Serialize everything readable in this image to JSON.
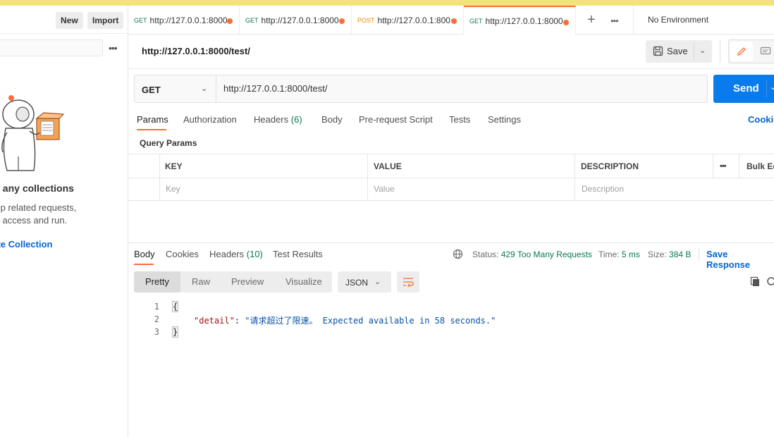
{
  "sidebar": {
    "new_label": "New",
    "import_label": "Import",
    "empty_title": "have any collections",
    "empty_desc_1": "you group related requests,",
    "empty_desc_2": "easier to access and run.",
    "create_link": "eate Collection"
  },
  "tabs": [
    {
      "method": "GET",
      "url": "http://127.0.0.1:8000"
    },
    {
      "method": "GET",
      "url": "http://127.0.0.1:8000"
    },
    {
      "method": "POST",
      "url": "http://127.0.0.1:800"
    },
    {
      "method": "GET",
      "url": "http://127.0.0.1:8000",
      "active": true
    }
  ],
  "environment": "No Environment",
  "request": {
    "title": "http://127.0.0.1:8000/test/",
    "save_label": "Save",
    "method": "GET",
    "url": "http://127.0.0.1:8000/test/",
    "send_label": "Send",
    "subtabs": {
      "params": "Params",
      "authorization": "Authorization",
      "headers": "Headers",
      "headers_count": "(6)",
      "body": "Body",
      "prerequest": "Pre-request Script",
      "tests": "Tests",
      "settings": "Settings"
    },
    "cookies_link": "Cookie",
    "query_params_title": "Query Params",
    "table": {
      "headers": {
        "key": "KEY",
        "value": "VALUE",
        "description": "DESCRIPTION",
        "bulk": "Bulk Ed"
      },
      "placeholders": {
        "key": "Key",
        "value": "Value",
        "description": "Description"
      }
    }
  },
  "response": {
    "tabs": {
      "body": "Body",
      "cookies": "Cookies",
      "headers": "Headers",
      "headers_count": "(10)",
      "test_results": "Test Results"
    },
    "status_label": "Status:",
    "status_value": "429 Too Many Requests",
    "time_label": "Time:",
    "time_value": "5 ms",
    "size_label": "Size:",
    "size_value": "384 B",
    "save_response": "Save Response",
    "views": {
      "pretty": "Pretty",
      "raw": "Raw",
      "preview": "Preview",
      "visualize": "Visualize"
    },
    "format": "JSON",
    "code": {
      "line_numbers": [
        "1",
        "2",
        "3"
      ],
      "open_brace": "{",
      "close_brace": "}",
      "key": "\"detail\"",
      "colon": ": ",
      "value": "\"请求超过了限速。 Expected available in 58 seconds.\""
    }
  },
  "colors": {
    "accent": "#ff6c37",
    "send": "#097bed",
    "status_ok_green": "#0b7a4f",
    "link": "#0265d2"
  }
}
